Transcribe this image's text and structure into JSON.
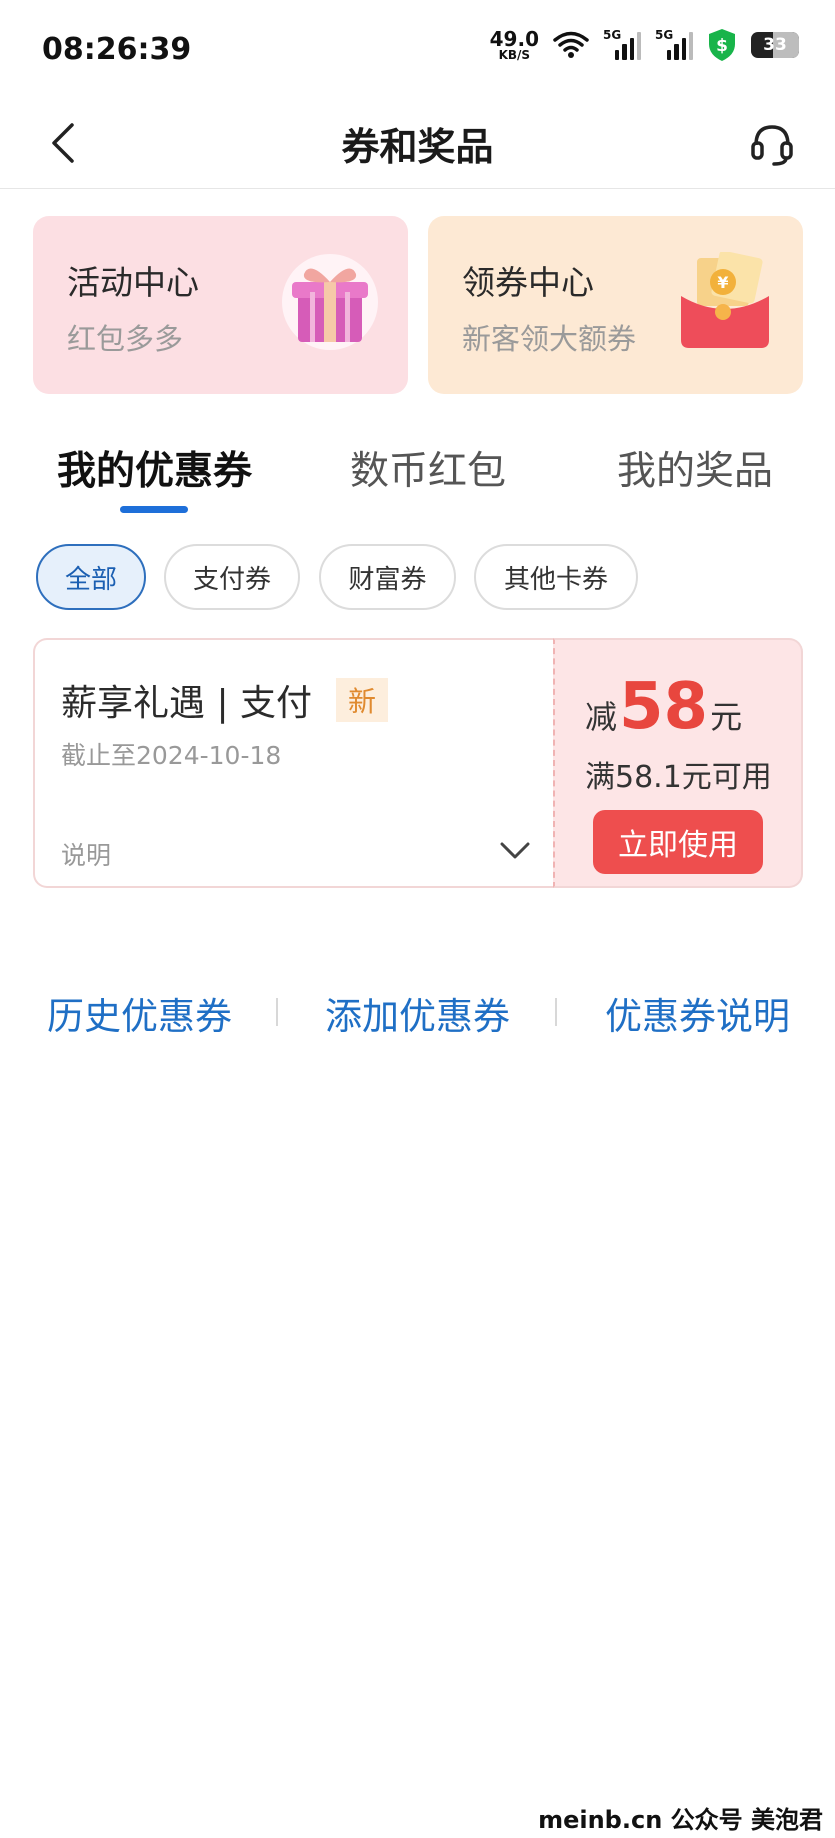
{
  "status": {
    "time": "08:26:39",
    "net_speed": "49.0",
    "net_unit": "KB/S",
    "signal1_label": "5G",
    "signal2_label": "5G",
    "battery": "33"
  },
  "header": {
    "title": "券和奖品",
    "back_icon": "chevron-left-icon",
    "support_icon": "headset-icon"
  },
  "promos": [
    {
      "title": "活动中心",
      "subtitle": "红包多多",
      "icon": "gift-box-icon"
    },
    {
      "title": "领券中心",
      "subtitle": "新客领大额券",
      "icon": "red-envelope-icon"
    }
  ],
  "tabs": [
    {
      "label": "我的优惠券",
      "active": true
    },
    {
      "label": "数币红包",
      "active": false
    },
    {
      "label": "我的奖品",
      "active": false
    }
  ],
  "filters": [
    {
      "label": "全部",
      "active": true
    },
    {
      "label": "支付券",
      "active": false
    },
    {
      "label": "财富券",
      "active": false
    },
    {
      "label": "其他卡券",
      "active": false
    }
  ],
  "coupon": {
    "name": "薪享礼遇 | 支付",
    "badge": "新",
    "expire": "截止至2024-10-18",
    "desc_label": "说明",
    "amount_prefix": "减",
    "amount": "58",
    "amount_unit": "元",
    "condition": "满58.1元可用",
    "action": "立即使用"
  },
  "links": {
    "history": "历史优惠券",
    "add": "添加优惠券",
    "explain": "优惠券说明"
  },
  "watermark": "meinb.cn  公众号 美泡君",
  "colors": {
    "accent_blue": "#1e6fd9",
    "coupon_red": "#e8463e",
    "button_red": "#ee4e4e"
  }
}
